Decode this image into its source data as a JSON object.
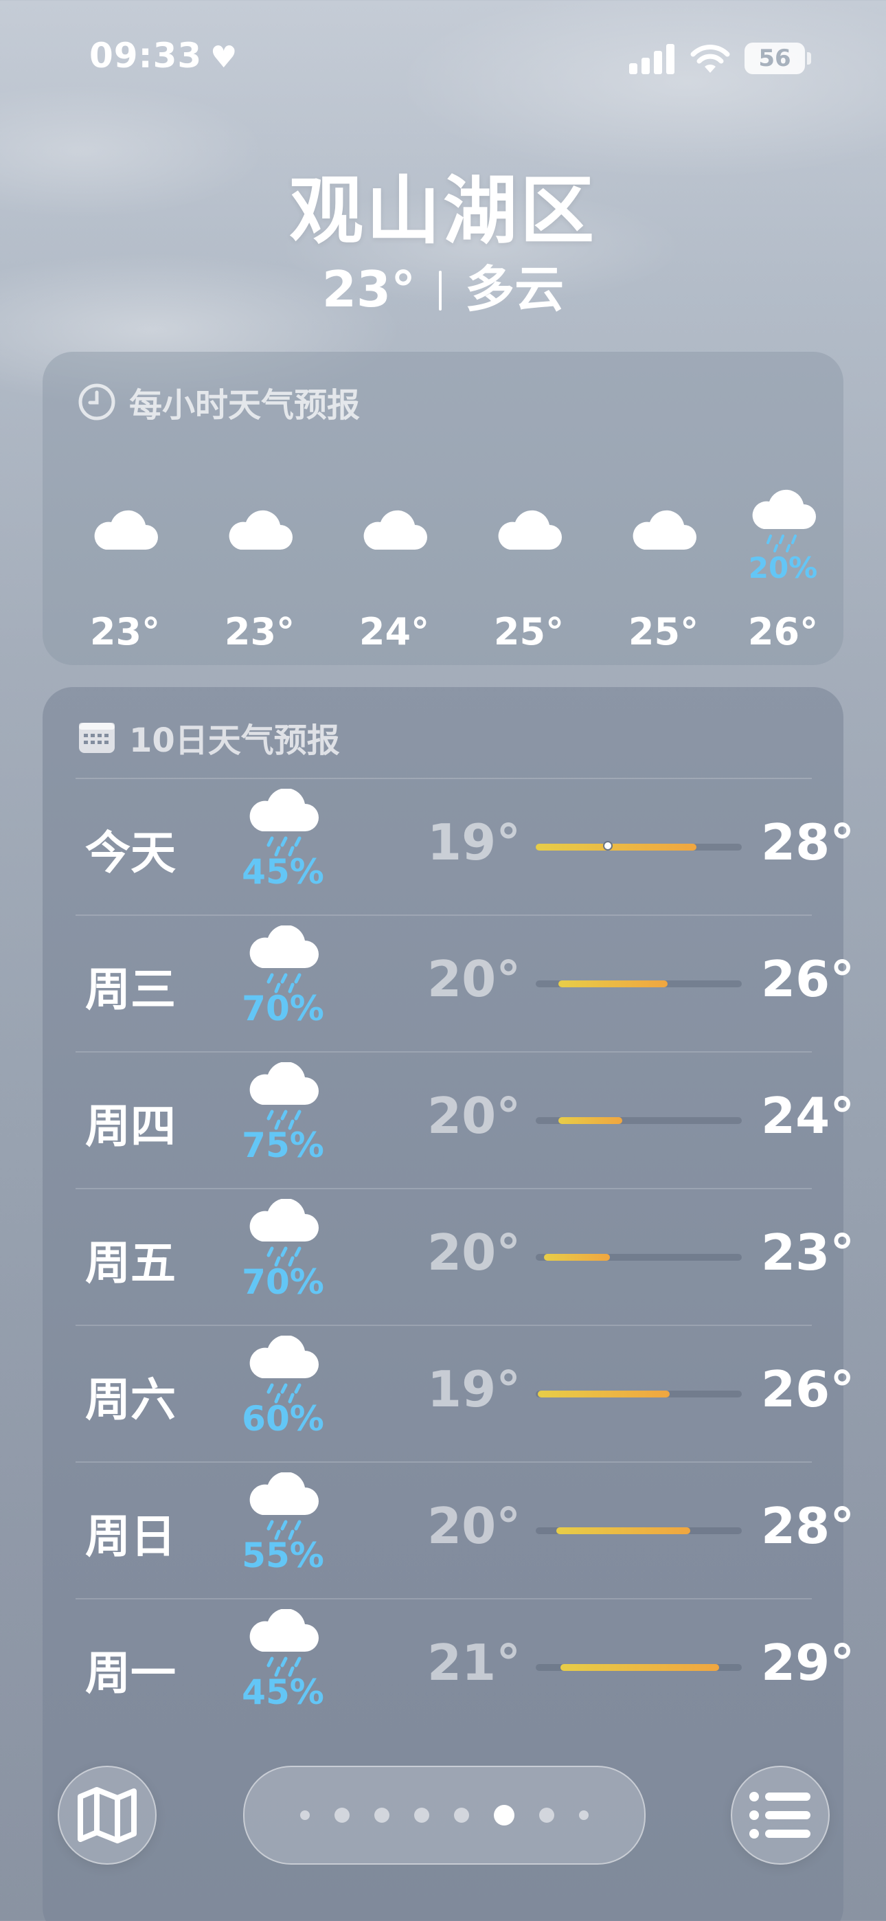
{
  "status_bar": {
    "time": "09:33",
    "battery": "56"
  },
  "header": {
    "location": "观山湖区",
    "temperature": "23°",
    "condition": "多云"
  },
  "hourly": {
    "title": "每小时天气预报",
    "items": [
      {
        "icon": "cloud-icon",
        "temp": "23°"
      },
      {
        "icon": "cloud-icon",
        "temp": "23°"
      },
      {
        "icon": "cloud-icon",
        "temp": "24°"
      },
      {
        "icon": "cloud-icon",
        "temp": "25°"
      },
      {
        "icon": "cloud-icon",
        "temp": "25°"
      },
      {
        "icon": "cloud-rain-icon",
        "precip": "20%",
        "temp": "26°"
      }
    ]
  },
  "daily": {
    "title": "10日天气预报",
    "days": [
      {
        "name": "今天",
        "pop": "45%",
        "low": "19°",
        "high": "28°",
        "range_start": 0.0,
        "range_end": 0.78,
        "current_marker": 0.35
      },
      {
        "name": "周三",
        "pop": "70%",
        "low": "20°",
        "high": "26°",
        "range_start": 0.11,
        "range_end": 0.64
      },
      {
        "name": "周四",
        "pop": "75%",
        "low": "20°",
        "high": "24°",
        "range_start": 0.11,
        "range_end": 0.42
      },
      {
        "name": "周五",
        "pop": "70%",
        "low": "20°",
        "high": "23°",
        "range_start": 0.04,
        "range_end": 0.36
      },
      {
        "name": "周六",
        "pop": "60%",
        "low": "19°",
        "high": "26°",
        "range_start": 0.01,
        "range_end": 0.65
      },
      {
        "name": "周日",
        "pop": "55%",
        "low": "20°",
        "high": "28°",
        "range_start": 0.1,
        "range_end": 0.75
      },
      {
        "name": "周一",
        "pop": "45%",
        "low": "21°",
        "high": "29°",
        "range_start": 0.12,
        "range_end": 0.89
      }
    ]
  },
  "colors": {
    "precip": "#63c6f6",
    "range_start": "#e7cd48",
    "range_end": "#f0a640"
  }
}
